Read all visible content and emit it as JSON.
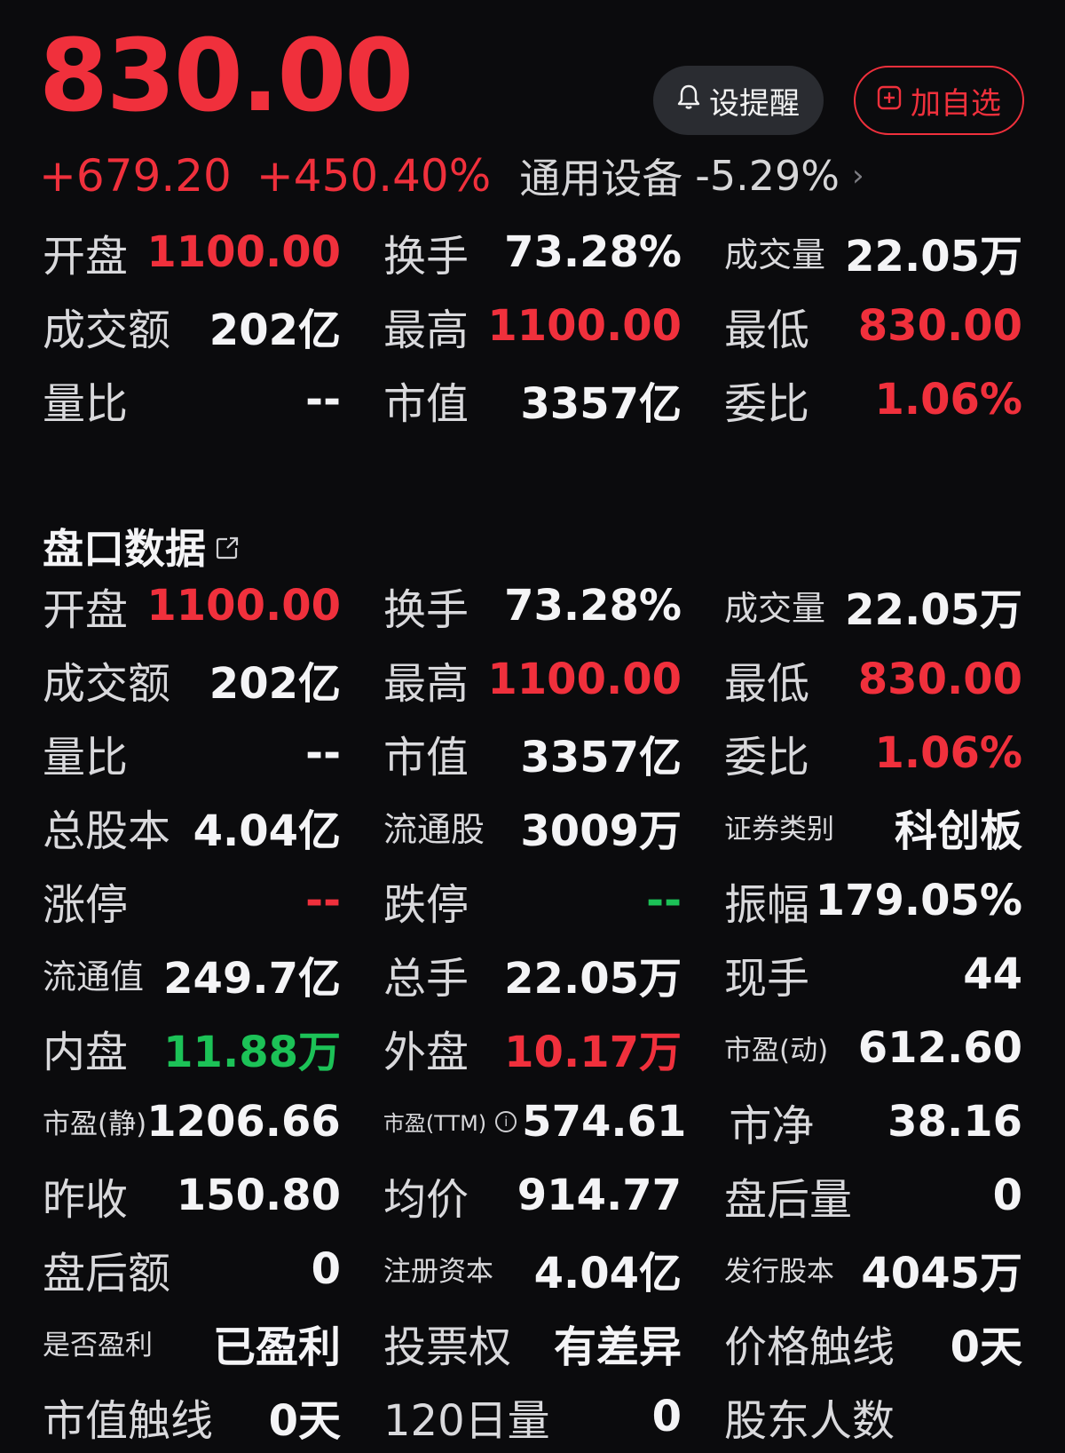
{
  "quote": {
    "price": "830.00",
    "change": "+679.20",
    "change_pct": "+450.40%",
    "sector_name": "通用设备",
    "sector_change": "-5.29%",
    "sector_chevron": "›"
  },
  "buttons": {
    "alert_label": "设提醒",
    "alert_icon": "bell-icon",
    "watch_label": "加自选",
    "watch_icon": "plus-square-icon"
  },
  "summary": [
    [
      {
        "label": "开盘",
        "value": "1100.00",
        "color": "red"
      },
      {
        "label": "换手",
        "value": "73.28%",
        "color": "white"
      },
      {
        "label": "成交量",
        "value": "22.05万",
        "color": "white"
      }
    ],
    [
      {
        "label": "成交额",
        "value": "202亿",
        "color": "white"
      },
      {
        "label": "最高",
        "value": "1100.00",
        "color": "red"
      },
      {
        "label": "最低",
        "value": "830.00",
        "color": "red"
      }
    ],
    [
      {
        "label": "量比",
        "value": "--",
        "color": "white"
      },
      {
        "label": "市值",
        "value": "3357亿",
        "color": "white"
      },
      {
        "label": "委比",
        "value": "1.06%",
        "color": "red"
      }
    ]
  ],
  "section": {
    "title": "盘口数据",
    "edit_icon": "external-edit-icon"
  },
  "details": [
    [
      {
        "label": "开盘",
        "value": "1100.00",
        "color": "red"
      },
      {
        "label": "换手",
        "value": "73.28%",
        "color": "white"
      },
      {
        "label": "成交量",
        "value": "22.05万",
        "color": "white"
      }
    ],
    [
      {
        "label": "成交额",
        "value": "202亿",
        "color": "white"
      },
      {
        "label": "最高",
        "value": "1100.00",
        "color": "red"
      },
      {
        "label": "最低",
        "value": "830.00",
        "color": "red"
      }
    ],
    [
      {
        "label": "量比",
        "value": "--",
        "color": "white"
      },
      {
        "label": "市值",
        "value": "3357亿",
        "color": "white"
      },
      {
        "label": "委比",
        "value": "1.06%",
        "color": "red"
      }
    ],
    [
      {
        "label": "总股本",
        "value": "4.04亿",
        "color": "white"
      },
      {
        "label": "流通股",
        "value": "3009万",
        "color": "white"
      },
      {
        "label": "证券类别",
        "value": "科创板",
        "color": "white"
      }
    ],
    [
      {
        "label": "涨停",
        "value": "--",
        "color": "red"
      },
      {
        "label": "跌停",
        "value": "--",
        "color": "green"
      },
      {
        "label": "振幅",
        "value": "179.05%",
        "color": "white"
      }
    ],
    [
      {
        "label": "流通值",
        "value": "249.7亿",
        "color": "white"
      },
      {
        "label": "总手",
        "value": "22.05万",
        "color": "white"
      },
      {
        "label": "现手",
        "value": "44",
        "color": "white"
      }
    ],
    [
      {
        "label": "内盘",
        "value": "11.88万",
        "color": "green"
      },
      {
        "label": "外盘",
        "value": "10.17万",
        "color": "red"
      },
      {
        "label": "市盈(动)",
        "value": "612.60",
        "color": "white"
      }
    ],
    [
      {
        "label": "市盈(静)",
        "value": "1206.66",
        "color": "white"
      },
      {
        "label": "市盈(TTM)",
        "value": "574.61",
        "color": "white",
        "info_icon": "i"
      },
      {
        "label": "市净",
        "value": "38.16",
        "color": "white"
      }
    ],
    [
      {
        "label": "昨收",
        "value": "150.80",
        "color": "white"
      },
      {
        "label": "均价",
        "value": "914.77",
        "color": "white"
      },
      {
        "label": "盘后量",
        "value": "0",
        "color": "white"
      }
    ],
    [
      {
        "label": "盘后额",
        "value": "0",
        "color": "white"
      },
      {
        "label": "注册资本",
        "value": "4.04亿",
        "color": "white"
      },
      {
        "label": "发行股本",
        "value": "4045万",
        "color": "white"
      }
    ],
    [
      {
        "label": "是否盈利",
        "value": "已盈利",
        "color": "white"
      },
      {
        "label": "投票权",
        "value": "有差异",
        "color": "white"
      },
      {
        "label": "价格触线",
        "value": "0天",
        "color": "white"
      }
    ],
    [
      {
        "label": "市值触线",
        "value": "0天",
        "color": "white"
      },
      {
        "label": "120日量",
        "value": "0",
        "color": "white"
      },
      {
        "label": "股东人数",
        "value": "",
        "color": "white"
      }
    ]
  ],
  "colors": {
    "up": "#f0303c",
    "down": "#1cc257",
    "background": "#0b0b0d"
  }
}
